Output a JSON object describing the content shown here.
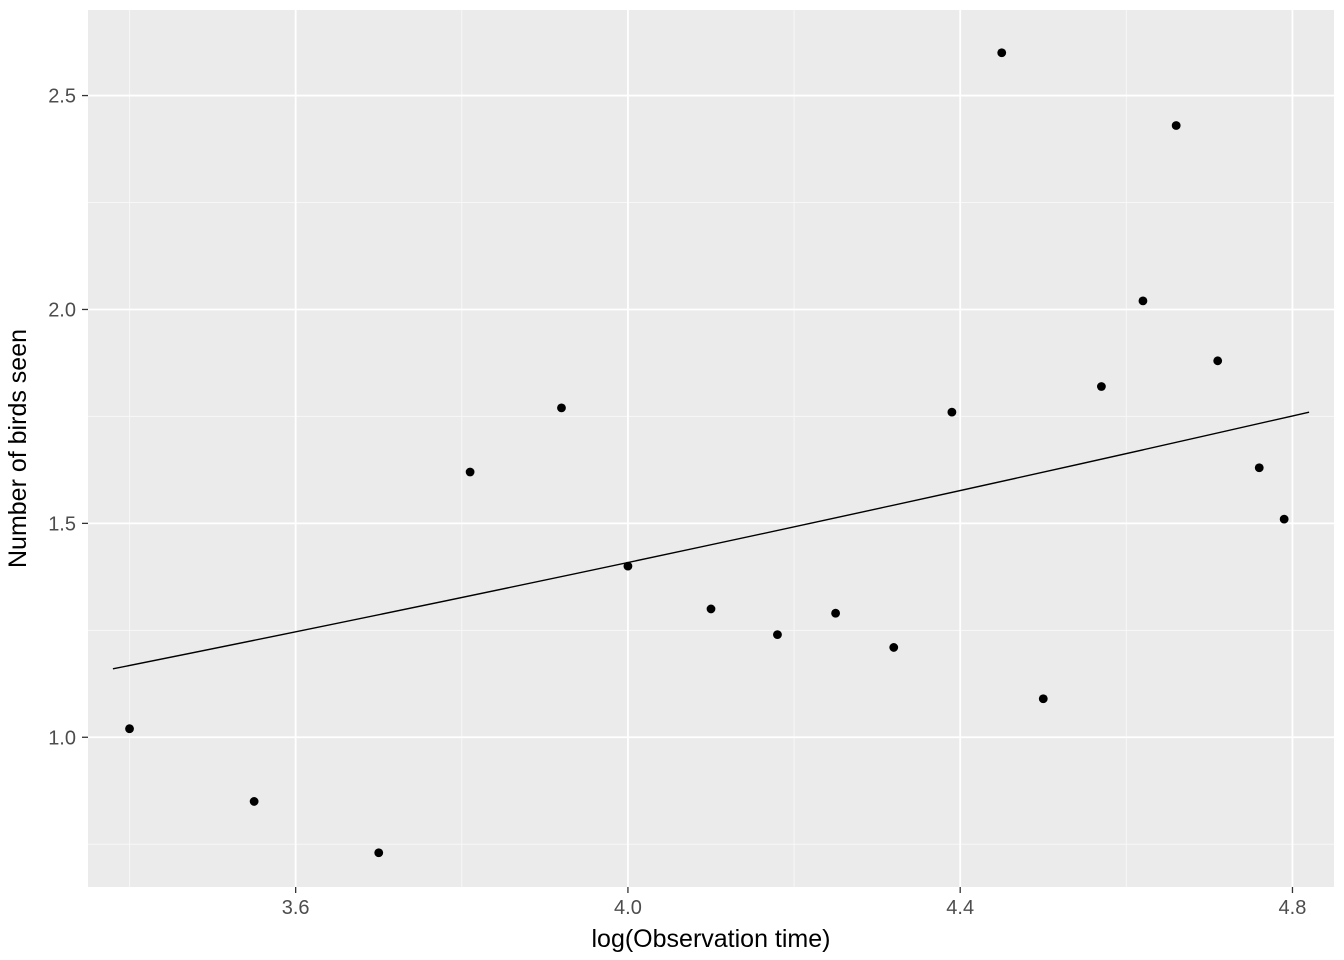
{
  "chart_data": {
    "type": "scatter",
    "xlabel": "log(Observation time)",
    "ylabel": "Number of birds seen",
    "xlim": [
      3.35,
      4.85
    ],
    "ylim": [
      0.65,
      2.7
    ],
    "x_ticks": [
      3.6,
      4.0,
      4.4,
      4.8
    ],
    "y_ticks": [
      1.0,
      1.5,
      2.0,
      2.5
    ],
    "x_minor": [
      3.4,
      3.8,
      4.2,
      4.6
    ],
    "y_minor": [
      0.75,
      1.25,
      1.75,
      2.25
    ],
    "points": [
      {
        "x": 3.4,
        "y": 1.02
      },
      {
        "x": 3.55,
        "y": 0.85
      },
      {
        "x": 3.7,
        "y": 0.73
      },
      {
        "x": 3.81,
        "y": 1.62
      },
      {
        "x": 3.92,
        "y": 1.77
      },
      {
        "x": 4.0,
        "y": 1.4
      },
      {
        "x": 4.1,
        "y": 1.3
      },
      {
        "x": 4.18,
        "y": 1.24
      },
      {
        "x": 4.25,
        "y": 1.29
      },
      {
        "x": 4.32,
        "y": 1.21
      },
      {
        "x": 4.39,
        "y": 1.76
      },
      {
        "x": 4.45,
        "y": 2.6
      },
      {
        "x": 4.5,
        "y": 1.09
      },
      {
        "x": 4.57,
        "y": 1.82
      },
      {
        "x": 4.62,
        "y": 2.02
      },
      {
        "x": 4.66,
        "y": 2.43
      },
      {
        "x": 4.71,
        "y": 1.88
      },
      {
        "x": 4.76,
        "y": 1.63
      },
      {
        "x": 4.79,
        "y": 1.51
      }
    ],
    "trend": {
      "x0": 3.38,
      "y0": 1.16,
      "x1": 4.82,
      "y1": 1.76
    }
  }
}
